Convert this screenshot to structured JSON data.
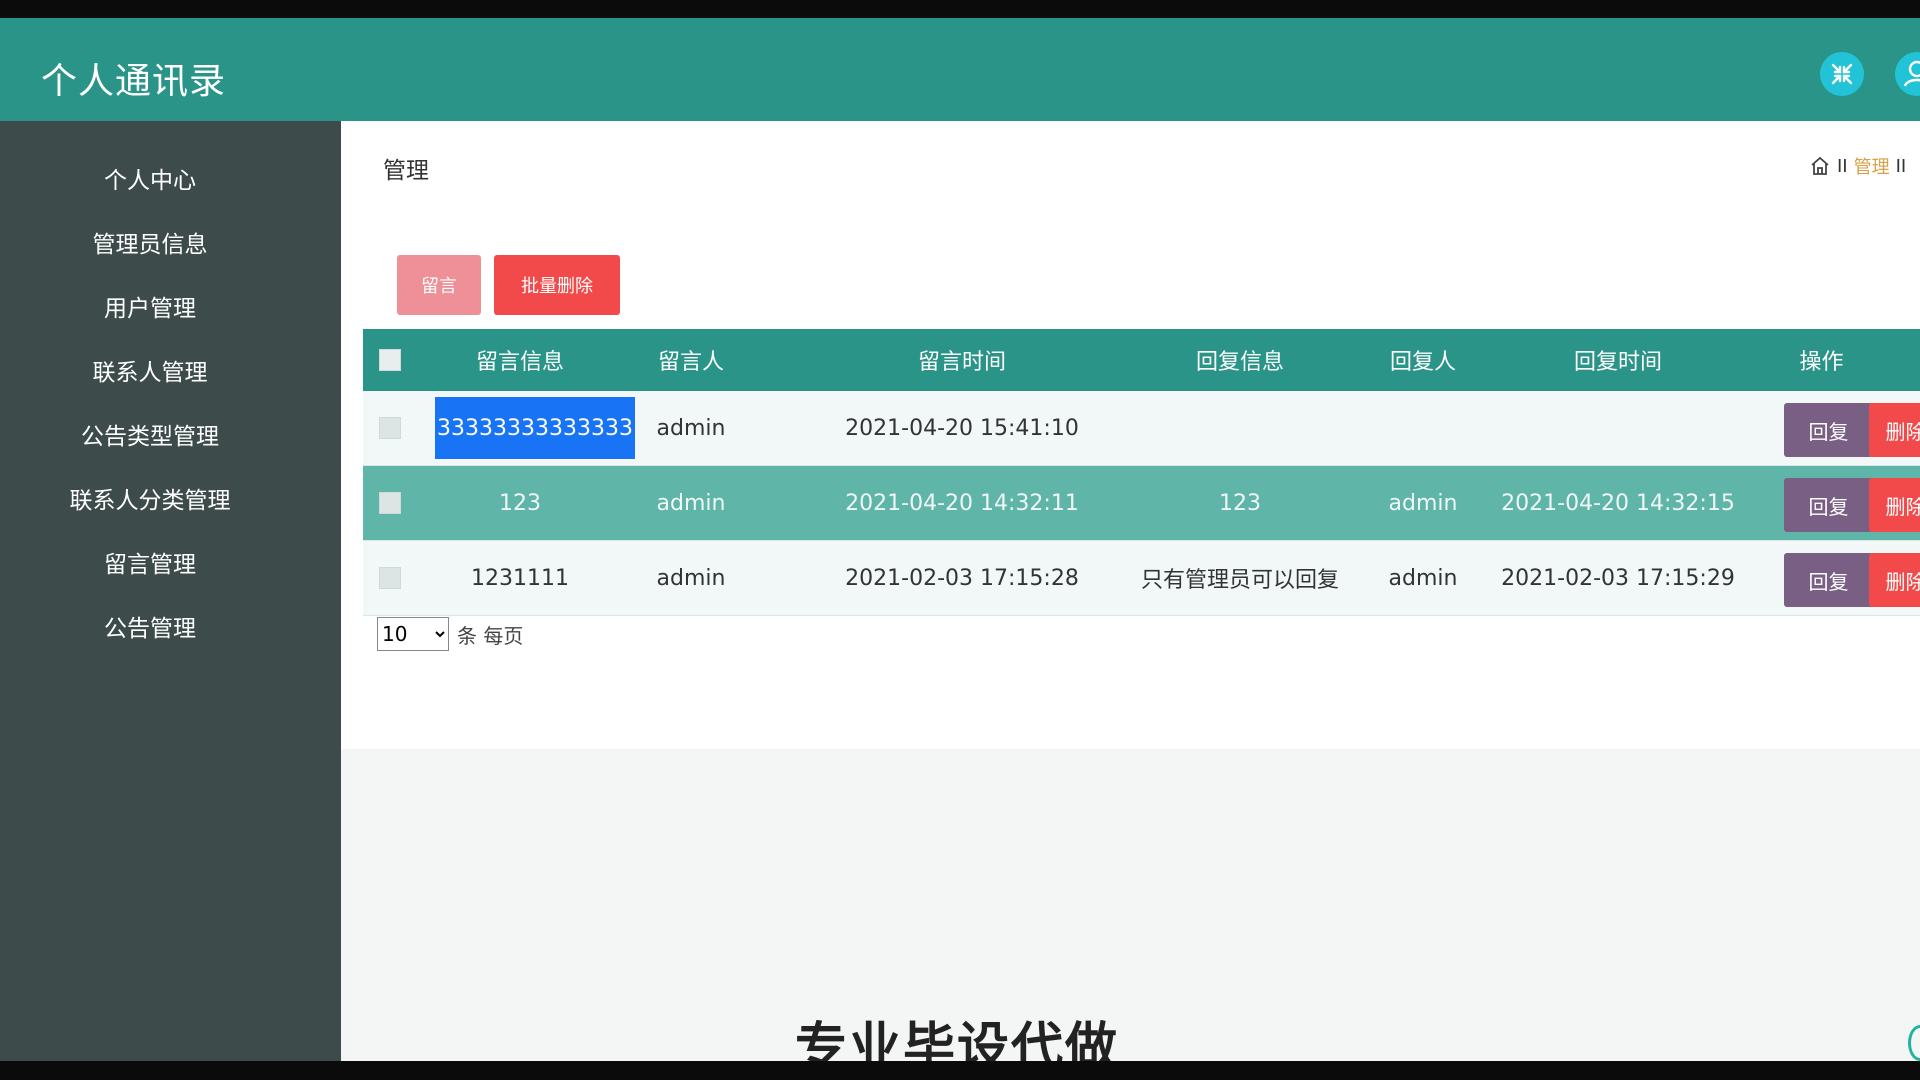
{
  "header": {
    "title": "个人通讯录",
    "fullscreen_icon": "fullscreen-exit-icon",
    "user_icon": "user-icon",
    "accent_color": "#2b9488"
  },
  "sidebar": {
    "items": [
      {
        "label": "个人中心"
      },
      {
        "label": "管理员信息"
      },
      {
        "label": "用户管理"
      },
      {
        "label": "联系人管理"
      },
      {
        "label": "公告类型管理"
      },
      {
        "label": "联系人分类管理"
      },
      {
        "label": "留言管理"
      },
      {
        "label": "公告管理"
      }
    ]
  },
  "page": {
    "title": "管理",
    "breadcrumb": {
      "home_icon": "home-icon",
      "sep": "II",
      "current": "管理",
      "sep2": "II"
    }
  },
  "toolbar": {
    "add_label": "留言",
    "batch_delete_label": "批量删除"
  },
  "table": {
    "columns": [
      "留言信息",
      "留言人",
      "留言时间",
      "回复信息",
      "回复人",
      "回复时间",
      "操作"
    ],
    "rows": [
      {
        "message": "33333333333333",
        "author": "admin",
        "time": "2021-04-20 15:41:10",
        "reply": "",
        "replier": "",
        "reply_time": "",
        "reply_btn": "回复",
        "delete_btn": "删除"
      },
      {
        "message": "123",
        "author": "admin",
        "time": "2021-04-20 14:32:11",
        "reply": "123",
        "replier": "admin",
        "reply_time": "2021-04-20 14:32:15",
        "reply_btn": "回复",
        "delete_btn": "删除"
      },
      {
        "message": "1231111",
        "author": "admin",
        "time": "2021-02-03 17:15:28",
        "reply": "只有管理员可以回复",
        "replier": "admin",
        "reply_time": "2021-02-03 17:15:29",
        "reply_btn": "回复",
        "delete_btn": "删除"
      }
    ]
  },
  "pager": {
    "page_size": "10",
    "suffix": "条 每页"
  },
  "watermark": "专业毕设代做"
}
